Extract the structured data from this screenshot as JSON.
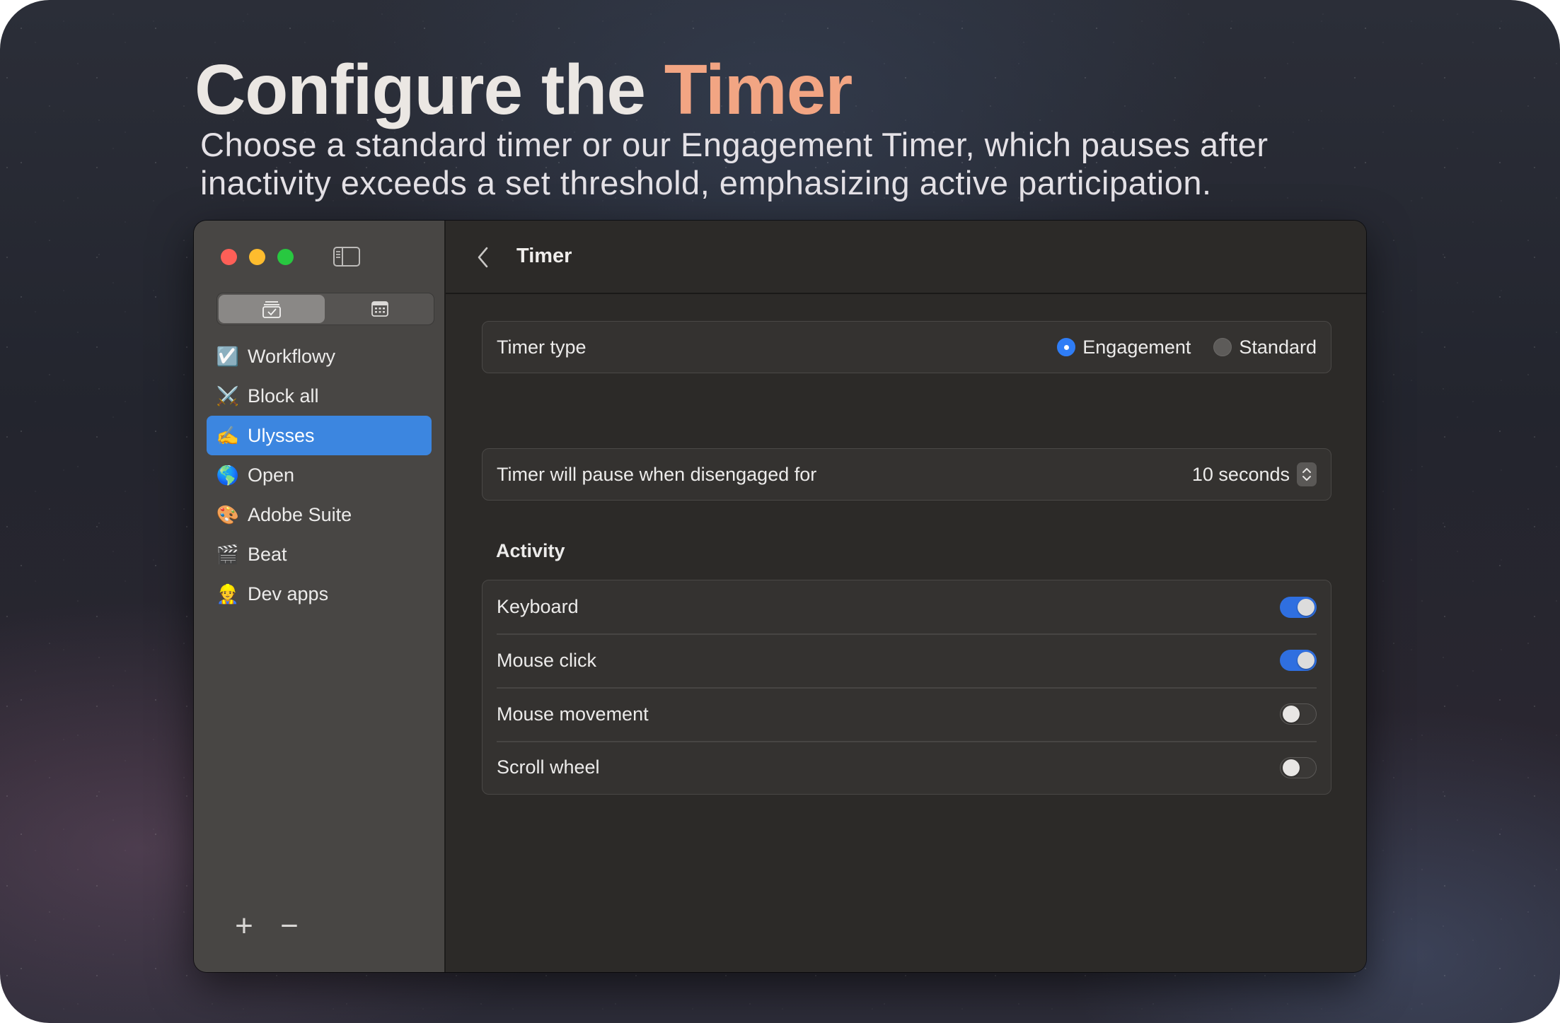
{
  "hero": {
    "title_main": "Configure the ",
    "title_accent": "Timer",
    "subtitle": "Choose a standard timer or our Engagement Timer, which pauses after inactivity exceeds a set threshold, emphasizing active participation."
  },
  "colors": {
    "accent": "#f2a583",
    "selection": "#3c86e0",
    "toggle_on": "#2f6fe0"
  },
  "sidebar": {
    "segments": [
      {
        "icon": "tray-checkmark-icon",
        "active": true
      },
      {
        "icon": "calendar-icon",
        "active": false
      }
    ],
    "items": [
      {
        "label": "Workflowy",
        "icon": "☑️",
        "selected": false
      },
      {
        "label": "Block all",
        "icon": "⚔️",
        "selected": false
      },
      {
        "label": "Ulysses",
        "icon": "✍️",
        "selected": true
      },
      {
        "label": "Open",
        "icon": "🌎",
        "selected": false
      },
      {
        "label": "Adobe Suite",
        "icon": "🎨",
        "selected": false
      },
      {
        "label": "Beat",
        "icon": "🎬",
        "selected": false
      },
      {
        "label": "Dev apps",
        "icon": "👷",
        "selected": false
      }
    ],
    "add_label": "+",
    "remove_label": "−"
  },
  "toolbar": {
    "title": "Timer"
  },
  "timer_type": {
    "label": "Timer type",
    "options": [
      {
        "label": "Engagement",
        "selected": true
      },
      {
        "label": "Standard",
        "selected": false
      }
    ]
  },
  "pause": {
    "label": "Timer will pause when disengaged for",
    "value": "10 seconds"
  },
  "activity": {
    "title": "Activity",
    "items": [
      {
        "label": "Keyboard",
        "on": true
      },
      {
        "label": "Mouse click",
        "on": true
      },
      {
        "label": "Mouse movement",
        "on": false
      },
      {
        "label": "Scroll wheel",
        "on": false
      }
    ]
  }
}
